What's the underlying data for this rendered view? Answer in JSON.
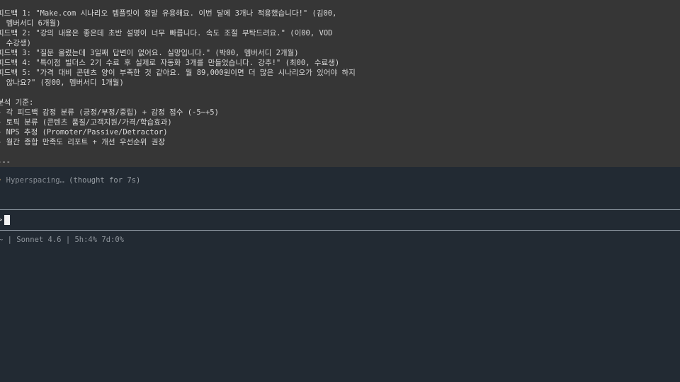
{
  "scrollback": {
    "lines": [
      "피드백 1: \"Make.com 시나리오 템플릿이 정말 유용해요. 이번 달에 3개나 적용했습니다!\" (김00,",
      "  멤버서디 6개월)",
      "피드백 2: \"강의 내용은 좋은데 초반 설명이 너무 빠릅니다. 속도 조절 부탁드려요.\" (이00, VOD",
      "  수강생)",
      "피드백 3: \"질문 올렸는데 3일째 답변이 없어요. 실망입니다.\" (박00, 멤버서디 2개월)",
      "피드백 4: \"특이점 빌더스 2기 수료 후 실제로 자동화 3개를 만들었습니다. 강추!\" (최00, 수료생)",
      "피드백 5: \"가격 대비 콘텐츠 양이 부족한 것 같아요. 월 89,000원이면 더 많은 시나리오가 있어야 하지",
      "  않나요?\" (정00, 멤버서디 1개월)",
      "",
      "분석 기준:",
      "- 각 피드백 감정 분류 (긍정/부정/중립) + 감정 점수 (-5~+5)",
      "- 토픽 분류 (콘텐츠 품질/고객지원/가격/학습효과)",
      "- NPS 추정 (Promoter/Passive/Detractor)",
      "- 월간 종합 만족도 리포트 + 개선 우선순위 권장",
      "",
      "---"
    ]
  },
  "status": {
    "bullet": "•",
    "verb": "Hyperspacing…",
    "detail": " (thought for 7s)"
  },
  "prompt": {
    "symbol": ">"
  },
  "footer": {
    "text": "~ | Sonnet 4.6 | 5h:4% 7d:0%"
  }
}
